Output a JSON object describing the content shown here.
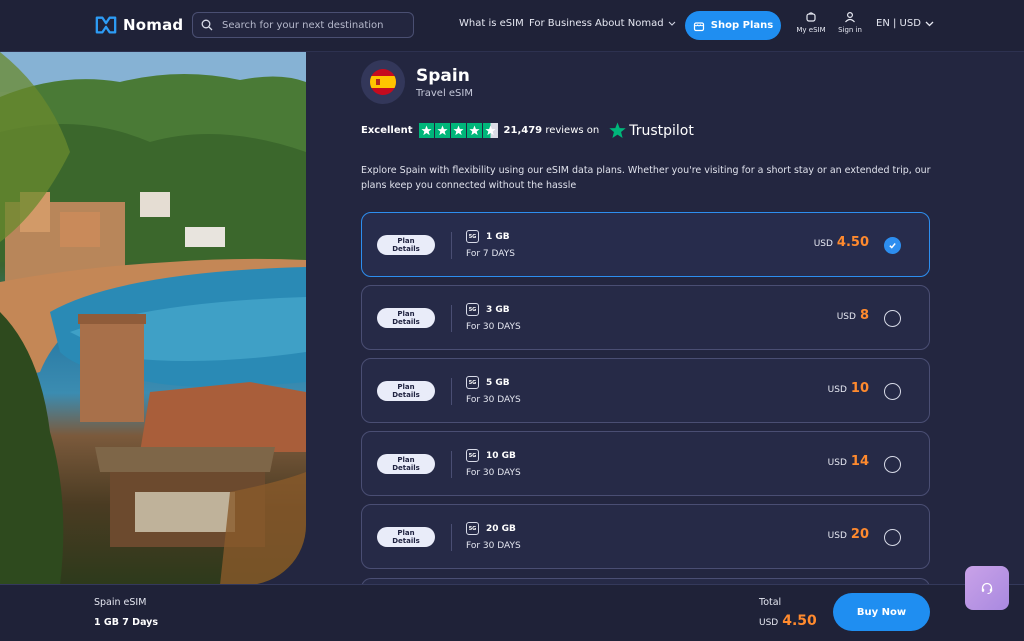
{
  "header": {
    "logo_text": "Nomad",
    "search_placeholder": "Search for your next destination",
    "nav": {
      "what_is_esim": "What is eSIM",
      "for_business": "For Business",
      "about": "About Nomad"
    },
    "shop_plans": "Shop Plans",
    "my_esim": "My eSIM",
    "sign_in": "Sign in",
    "lang_currency": "EN | USD"
  },
  "country": {
    "name": "Spain",
    "subtitle": "Travel eSIM"
  },
  "rating": {
    "label": "Excellent",
    "reviews_count": "21,479",
    "reviews_text": "reviews on",
    "provider": "Trustpilot"
  },
  "description": "Explore Spain with flexibility using our eSIM data plans. Whether you're visiting for a short stay or an extended trip, our plans keep you connected without the hassle",
  "plans": [
    {
      "details_label": "Plan Details",
      "badge": "5G",
      "data": "1 GB",
      "days": "For 7 DAYS",
      "currency": "USD",
      "price": "4.50",
      "selected": true
    },
    {
      "details_label": "Plan Details",
      "badge": "5G",
      "data": "3 GB",
      "days": "For 30 DAYS",
      "currency": "USD",
      "price": "8",
      "selected": false
    },
    {
      "details_label": "Plan Details",
      "badge": "5G",
      "data": "5 GB",
      "days": "For 30 DAYS",
      "currency": "USD",
      "price": "10",
      "selected": false
    },
    {
      "details_label": "Plan Details",
      "badge": "5G",
      "data": "10 GB",
      "days": "For 30 DAYS",
      "currency": "USD",
      "price": "14",
      "selected": false
    },
    {
      "details_label": "Plan Details",
      "badge": "5G",
      "data": "20 GB",
      "days": "For 30 DAYS",
      "currency": "USD",
      "price": "20",
      "selected": false
    }
  ],
  "bottom_bar": {
    "country": "Spain eSIM",
    "plan": "1 GB 7 Days",
    "total_label": "Total",
    "currency": "USD",
    "total": "4.50",
    "buy_now": "Buy Now"
  },
  "colors": {
    "background": "#232640",
    "accent": "#1f8ef1",
    "price": "#ff8a2e",
    "trustpilot_green": "#00b67a"
  }
}
